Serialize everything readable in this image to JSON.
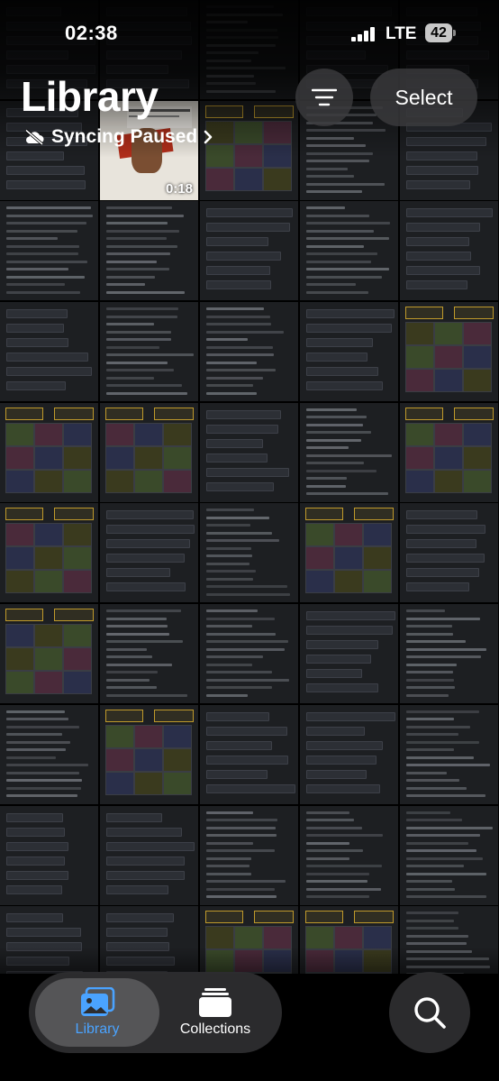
{
  "status_bar": {
    "time": "02:38",
    "network": "LTE",
    "battery": "42"
  },
  "header": {
    "title": "Library",
    "sync_status": "Syncing Paused",
    "select_label": "Select"
  },
  "video_thumb": {
    "duration": "0:18"
  },
  "tabs": [
    {
      "label": "Library",
      "icon": "photo-stack-icon",
      "selected": true
    },
    {
      "label": "Collections",
      "icon": "collections-icon",
      "selected": false
    }
  ],
  "colors": {
    "accent": "#4aa3ff",
    "thumb_bg": "#1d1f22",
    "highlight": "#c09a2b"
  }
}
